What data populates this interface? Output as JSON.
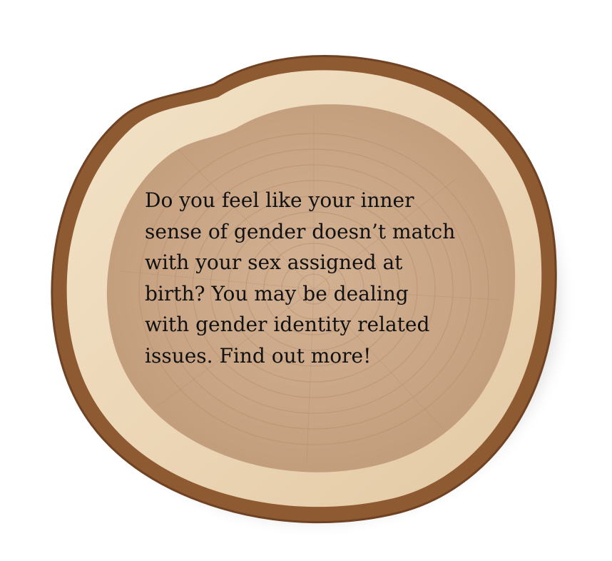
{
  "message": "Do you feel like your inner\nsense of gender doesn’t match\nwith your sex assigned at\nbirth? You may be dealing\nwith gender identity related\nissues. Find out more!",
  "colors": {
    "bark_dark": "#8e5a32",
    "sapwood": "#ecd6b6",
    "heartwood": "#c9a585",
    "text": "#111111"
  }
}
